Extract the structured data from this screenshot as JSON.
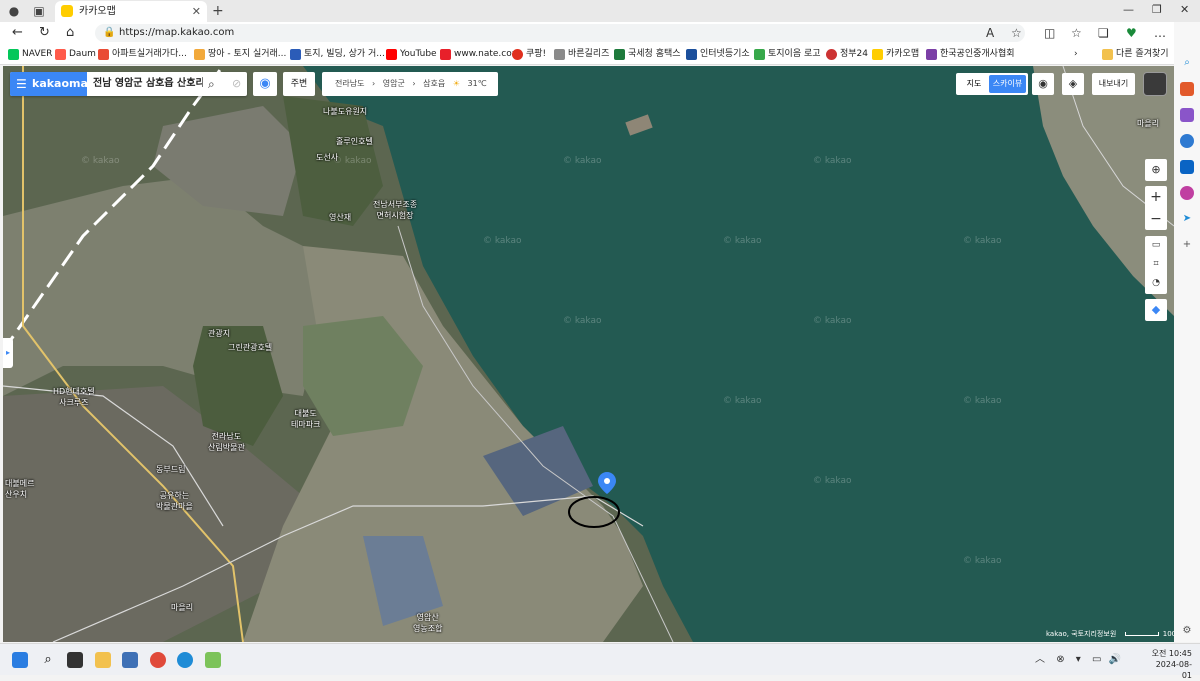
{
  "browser": {
    "tab_title": "카카오맵",
    "url": "https://map.kakao.com",
    "bookmarks": [
      "NAVER",
      "Daum",
      "아파트실거래가다...",
      "땅아 - 토지 실거래...",
      "토지, 빌딩, 상가 거...",
      "YouTube",
      "www.nate.com",
      "쿠팡!",
      "바른길리즈",
      "국세청 홈택스",
      "인터넷등기소",
      "토지이음 로고",
      "정부24",
      "카카오맵",
      "한국공인중개사협회"
    ],
    "other_bookmarks": "다른 즐겨찾기"
  },
  "map": {
    "logo": "kakaomap",
    "search_text": "전남 영암군 삼호읍 산호리",
    "nearby_label": "주변",
    "breadcrumb": [
      "전라남도",
      "영암군",
      "삼호읍"
    ],
    "weather": "31℃",
    "map_types": {
      "map": "지도",
      "skyview": "스카이뷰"
    },
    "map_type_active": "스카이뷰",
    "export_label": "내보내기",
    "attribution": "kakao, 국토지리정보원",
    "scale_label": "100m",
    "watermark": "© kakao",
    "places": [
      "나불도유원지",
      "홀루인호텔",
      "도선사",
      "영산재",
      "전남서부조종\n면허시험장",
      "관광지",
      "그린관광호텔",
      "HD현대호텔\n사크루즈",
      "대불도\n테마파크",
      "전라남도\n산림박물관",
      "동부드림",
      "공유하는\n박물관마을",
      "대불메르\n산우치",
      "에너뮤",
      "영암산\n영농조합",
      "영암에너지\n박물관",
      "마을리"
    ]
  },
  "taskbar": {
    "time": "오전 10:45",
    "date": "2024-08-01"
  }
}
